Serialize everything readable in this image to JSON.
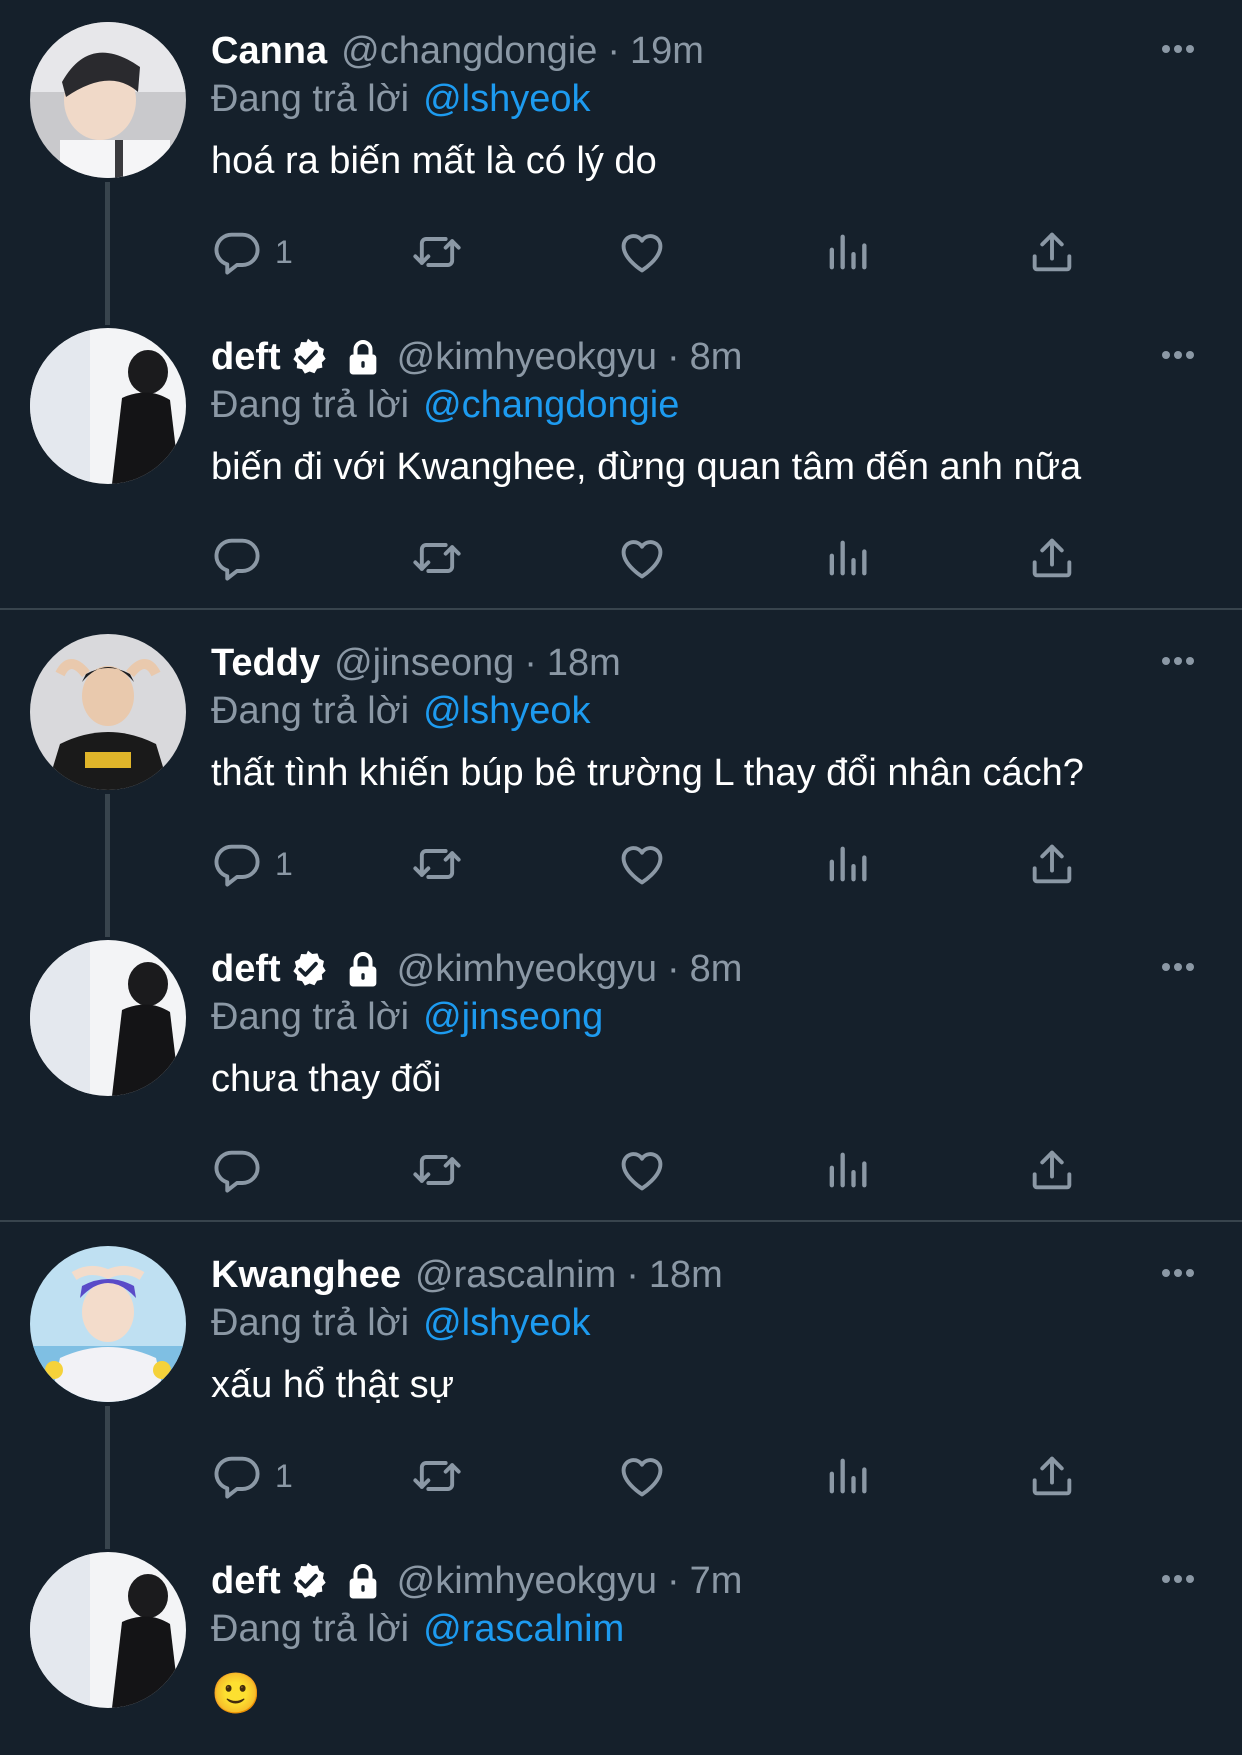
{
  "colors": {
    "background": "#15202b",
    "secondary_text": "#8b98a5",
    "link": "#1d9bf0",
    "divider": "#38444d"
  },
  "tweets": [
    {
      "name": "Canna",
      "handle": "@changdongie",
      "time": "19m",
      "replying_label": "Đang trả lời",
      "mention": "@lshyeok",
      "text": "hoá ra biến mất là có lý do",
      "reply_count": "1"
    },
    {
      "name": "deft",
      "handle": "@kimhyeokgyu",
      "time": "8m",
      "replying_label": "Đang trả lời",
      "mention": "@changdongie",
      "text": "biến đi với Kwanghee, đừng quan tâm đến anh nữa",
      "reply_count": ""
    },
    {
      "name": "Teddy",
      "handle": "@jinseong",
      "time": "18m",
      "replying_label": "Đang trả lời",
      "mention": "@lshyeok",
      "text": "thất tình khiến búp bê trường L thay đổi nhân cách?",
      "reply_count": "1"
    },
    {
      "name": "deft",
      "handle": "@kimhyeokgyu",
      "time": "8m",
      "replying_label": "Đang trả lời",
      "mention": "@jinseong",
      "text": "chưa thay đổi",
      "reply_count": ""
    },
    {
      "name": "Kwanghee",
      "handle": "@rascalnim",
      "time": "18m",
      "replying_label": "Đang trả lời",
      "mention": "@lshyeok",
      "text": "xấu hổ thật sự",
      "reply_count": "1"
    },
    {
      "name": "deft",
      "handle": "@kimhyeokgyu",
      "time": "7m",
      "replying_label": "Đang trả lời",
      "mention": "@rascalnim",
      "text": "🙂",
      "reply_count": ""
    }
  ],
  "separator": "·",
  "icons": [
    "reply-icon",
    "retweet-icon",
    "like-icon",
    "views-icon",
    "share-icon",
    "more-icon",
    "verified-icon",
    "lock-icon"
  ]
}
